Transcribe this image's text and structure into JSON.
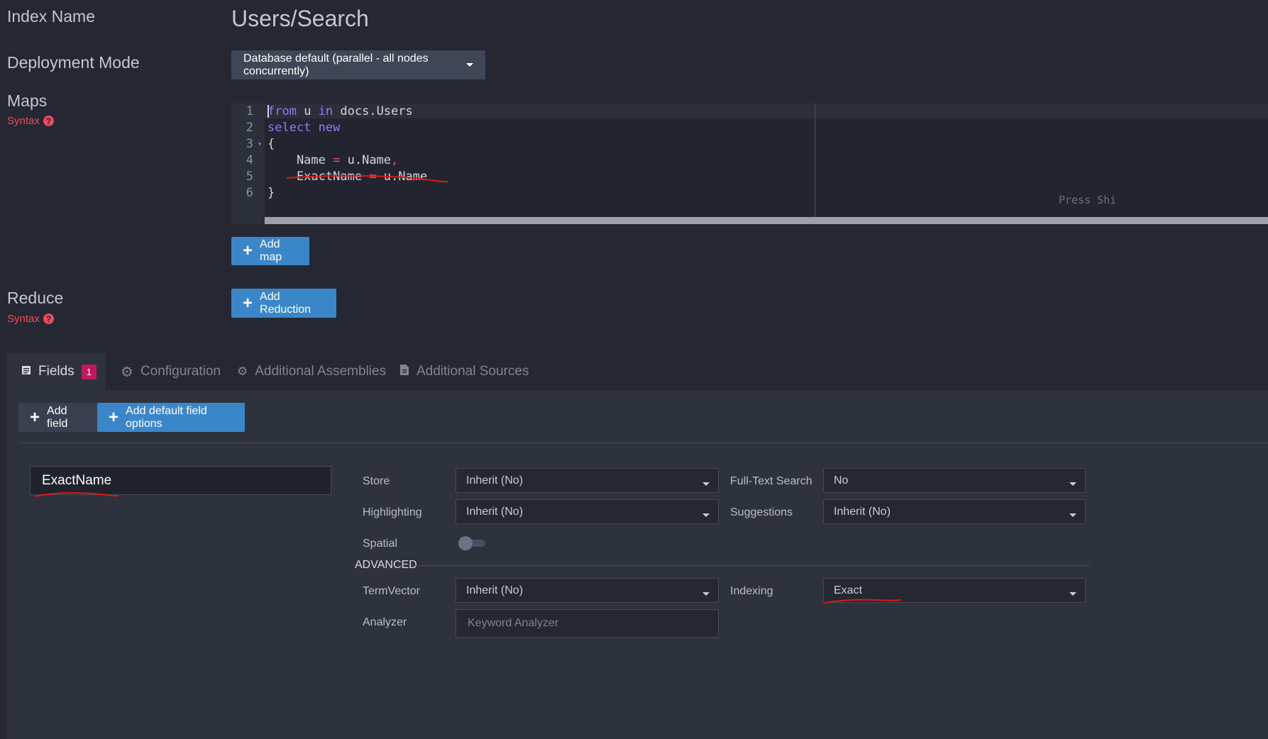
{
  "labels": {
    "index_name": "Index Name",
    "deployment_mode": "Deployment Mode",
    "maps": "Maps",
    "reduce": "Reduce",
    "syntax": "Syntax",
    "help": "?"
  },
  "index": {
    "name": "Users/Search"
  },
  "deployment": {
    "selected": "Database default (parallel - all nodes concurrently)"
  },
  "editor": {
    "line_numbers": [
      "1",
      "2",
      "3",
      "4",
      "5",
      "6"
    ],
    "hint": "Press Shi"
  },
  "buttons": {
    "add_map": "Add map",
    "add_reduction": "Add Reduction",
    "add_field": "Add field",
    "add_default_field_options": "Add default field options"
  },
  "tabs": [
    {
      "label": "Fields",
      "badge": "1",
      "icon": "list-icon",
      "active": true
    },
    {
      "label": "Configuration",
      "icon": "gear-icon"
    },
    {
      "label": "Additional Assemblies",
      "icon": "gears-icon"
    },
    {
      "label": "Additional Sources",
      "icon": "file-icon"
    }
  ],
  "field": {
    "name": "ExactName",
    "store_label": "Store",
    "store_value": "Inherit (No)",
    "fts_label": "Full-Text Search",
    "fts_value": "No",
    "highlighting_label": "Highlighting",
    "highlighting_value": "Inherit (No)",
    "suggestions_label": "Suggestions",
    "suggestions_value": "Inherit (No)",
    "spatial_label": "Spatial",
    "spatial_on": false,
    "advanced_label": "ADVANCED",
    "termvector_label": "TermVector",
    "termvector_value": "Inherit (No)",
    "indexing_label": "Indexing",
    "indexing_value": "Exact",
    "analyzer_label": "Analyzer",
    "analyzer_placeholder": "Keyword Analyzer"
  },
  "colors": {
    "background": "#252833",
    "accent": "#3b86c9",
    "syntax": "#ef4a5a",
    "badge": "#c2185b",
    "annotation": "#e01818"
  }
}
